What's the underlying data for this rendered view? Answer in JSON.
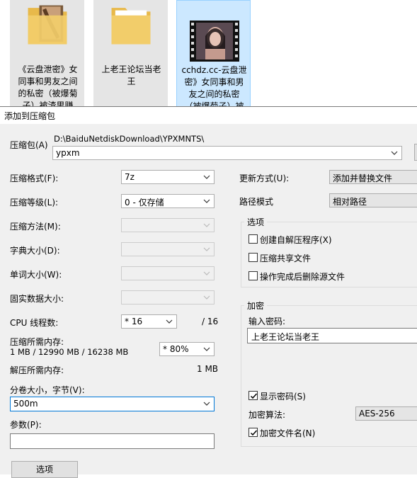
{
  "explorer": {
    "files": [
      {
        "name": "《云盘泄密》女同事和男友之间的私密（被爆菊子）被渣男赚",
        "kind": "folder-photo"
      },
      {
        "name": "上老王论坛当老王",
        "kind": "folder"
      },
      {
        "name": "cchdz.cc-云盘泄密》女同事和男友之间的私密（被爆菊子）被渣",
        "kind": "video"
      }
    ]
  },
  "dialog": {
    "title": "添加到压缩包",
    "archive": {
      "label": "压缩包(A)",
      "path": "D:\\BaiduNetdiskDownload\\YPXMNTS\\",
      "name": "ypxm"
    },
    "left": {
      "format": {
        "label": "压缩格式(F):",
        "value": "7z"
      },
      "level": {
        "label": "压缩等级(L):",
        "value": "0 - 仅存储"
      },
      "method": {
        "label": "压缩方法(M):",
        "value": ""
      },
      "dict": {
        "label": "字典大小(D):",
        "value": ""
      },
      "word": {
        "label": "单词大小(W):",
        "value": ""
      },
      "solid": {
        "label": "固实数据大小:",
        "value": ""
      },
      "cpu": {
        "label": "CPU 线程数:",
        "value": "* 16",
        "max": "/ 16"
      },
      "mem": {
        "label": "压缩所需内存:",
        "detail": "1 MB / 12990 MB / 16238 MB",
        "value": "* 80%"
      },
      "decomp": {
        "label": "解压所需内存:",
        "value": "1 MB"
      },
      "volume": {
        "label": "分卷大小，字节(V):",
        "value": "500m"
      },
      "params": {
        "label": "参数(P):",
        "value": ""
      },
      "options_button": "选项"
    },
    "right": {
      "update": {
        "label": "更新方式(U):",
        "value": "添加并替换文件"
      },
      "pathmode": {
        "label": "路径模式",
        "value": "相对路径"
      },
      "options": {
        "title": "选项",
        "sfx": "创建自解压程序(X)",
        "shared": "压缩共享文件",
        "delete": "操作完成后删除源文件"
      },
      "encryption": {
        "title": "加密",
        "pwd_label": "输入密码:",
        "pwd_value": "上老王论坛当老王",
        "show_pwd": "显示密码(S)",
        "method_label": "加密算法:",
        "method_value": "AES-256",
        "encrypt_names": "加密文件名(N)"
      }
    }
  }
}
